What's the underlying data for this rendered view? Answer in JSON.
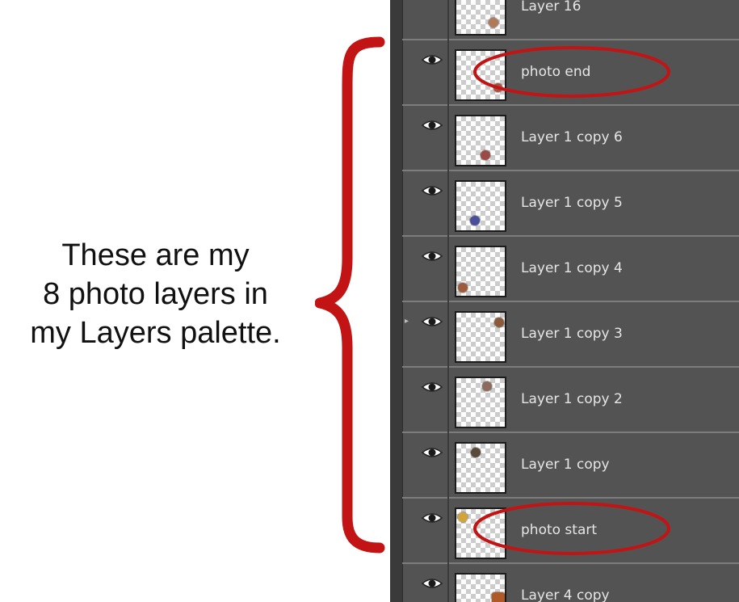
{
  "caption": {
    "line1": "These are my",
    "line2": "8 photo layers in",
    "line3": "my Layers palette."
  },
  "layers": [
    {
      "name": "Layer 16",
      "dot_color": "#b07a5a"
    },
    {
      "name": "photo end",
      "dot_color": "#a5523f"
    },
    {
      "name": "Layer 1 copy 6",
      "dot_color": "#9b4b45"
    },
    {
      "name": "Layer 1 copy 5",
      "dot_color": "#4a4f9a"
    },
    {
      "name": "Layer 1 copy 4",
      "dot_color": "#9e5a3c"
    },
    {
      "name": "Layer 1 copy 3",
      "dot_color": "#8a5a3b"
    },
    {
      "name": "Layer 1 copy 2",
      "dot_color": "#8c6a5c"
    },
    {
      "name": "Layer 1 copy",
      "dot_color": "#5a4a3a"
    },
    {
      "name": "photo start",
      "dot_color": "#d3a43a"
    },
    {
      "name": "Layer 4 copy",
      "dot_color": "#b05a2a"
    }
  ],
  "icons": {
    "visibility": "eye-icon",
    "collapse": "triangle-right-icon"
  },
  "colors": {
    "panel_bg": "#535353",
    "row_divider": "#7d7d7d",
    "layer_text": "#e6e6e6",
    "annotation_red": "#c21414"
  }
}
